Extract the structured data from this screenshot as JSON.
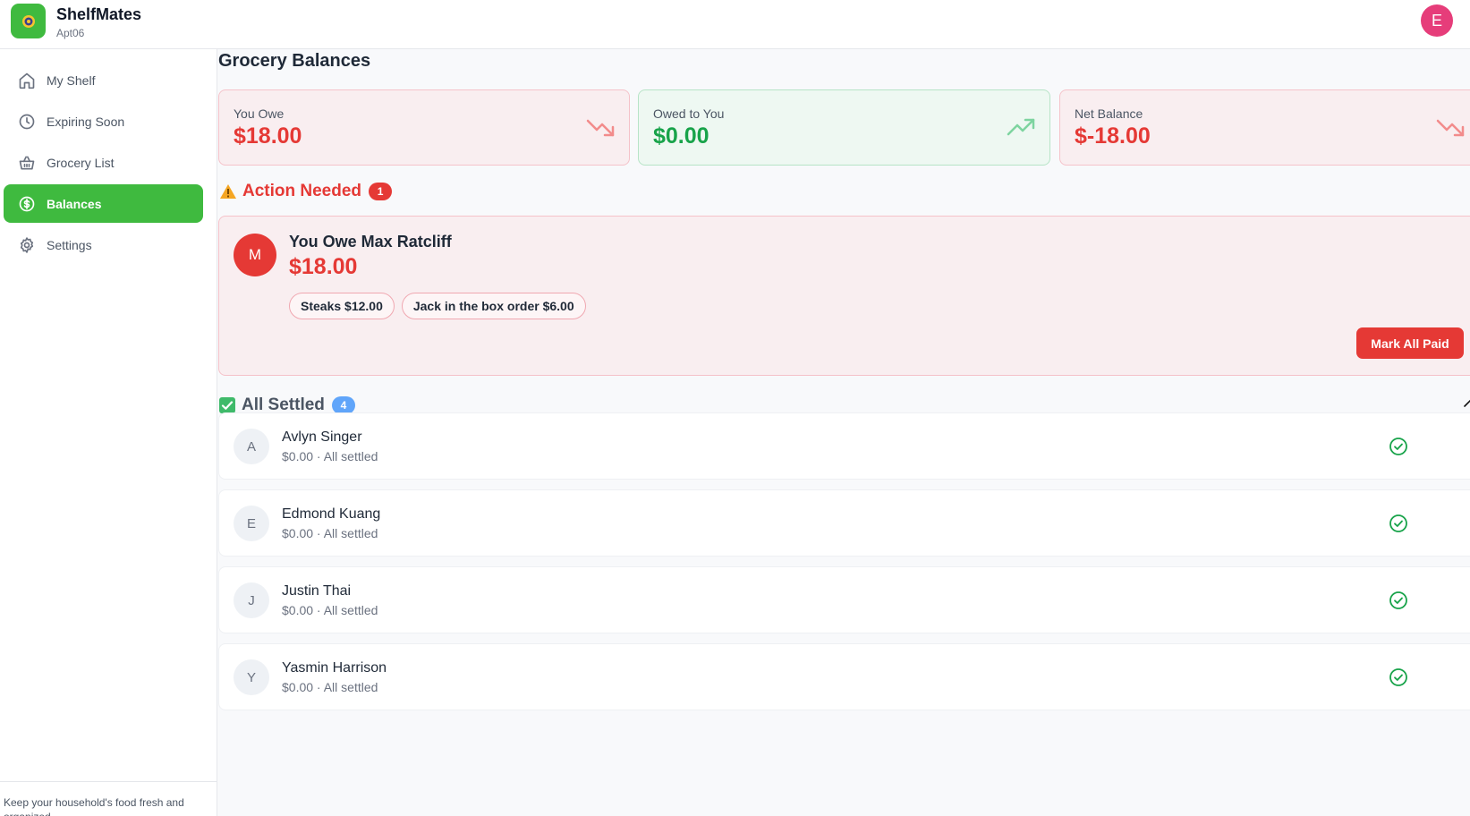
{
  "header": {
    "app_name": "ShelfMates",
    "household": "Apt06",
    "user_initial": "E"
  },
  "sidebar": {
    "items": [
      {
        "label": "My Shelf",
        "icon": "home-icon"
      },
      {
        "label": "Expiring Soon",
        "icon": "clock-icon"
      },
      {
        "label": "Grocery List",
        "icon": "basket-icon"
      },
      {
        "label": "Balances",
        "icon": "dollar-circle-icon",
        "active": true
      },
      {
        "label": "Settings",
        "icon": "gear-icon"
      }
    ],
    "footer_text": "Keep your household's food fresh and organized"
  },
  "page": {
    "title": "Grocery Balances"
  },
  "summary": {
    "you_owe": {
      "label": "You Owe",
      "value": "$18.00",
      "icon": "trending-down-icon"
    },
    "owed_to_you": {
      "label": "Owed to You",
      "value": "$0.00",
      "icon": "trending-up-icon"
    },
    "net_balance": {
      "label": "Net Balance",
      "value": "$-18.00",
      "icon": "trending-down-icon"
    }
  },
  "action_needed": {
    "label": "Action Needed",
    "count": "1",
    "item": {
      "initial": "M",
      "title": "You Owe Max Ratcliff",
      "amount": "$18.00",
      "chips": [
        "Steaks $12.00",
        "Jack in the box order $6.00"
      ],
      "button_label": "Mark All Paid"
    }
  },
  "all_settled": {
    "label": "All Settled",
    "count": "4",
    "rows": [
      {
        "initial": "A",
        "name": "Avlyn Singer",
        "status": "$0.00 · All settled"
      },
      {
        "initial": "E",
        "name": "Edmond Kuang",
        "status": "$0.00 · All settled"
      },
      {
        "initial": "J",
        "name": "Justin Thai",
        "status": "$0.00 · All settled"
      },
      {
        "initial": "Y",
        "name": "Yasmin Harrison",
        "status": "$0.00 · All settled"
      }
    ]
  },
  "colors": {
    "brand": "#3fba3f",
    "danger": "#e53935",
    "success": "#18a34a",
    "info_badge": "#60a5fa"
  }
}
